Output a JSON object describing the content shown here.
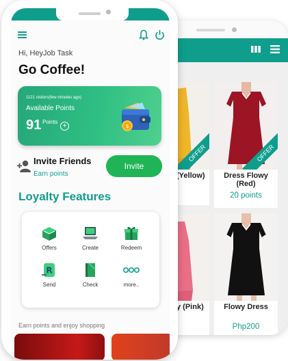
{
  "colors": {
    "primary": "#0f9e8c",
    "points_card": "#2fbf83",
    "invite_button": "#1fb455"
  },
  "home": {
    "greeting": "Hi, HeyJob Task",
    "brand_title": "Go Coffee!",
    "points_card": {
      "visitors_count": "1121 visitors",
      "visitors_note": "(few minutes ago)",
      "label": "Available Points",
      "value": "91",
      "unit": "Points"
    },
    "invite": {
      "title": "Invite Friends",
      "subtitle": "Earn points",
      "button": "Invite"
    },
    "features_title": "Loyalty Features",
    "features": [
      {
        "label": "Offers",
        "icon": "offers-box-icon"
      },
      {
        "label": "Create",
        "icon": "laptop-icon"
      },
      {
        "label": "Redeem",
        "icon": "gift-icon"
      },
      {
        "label": "Send",
        "icon": "send-icon"
      },
      {
        "label": "Check",
        "icon": "book-icon"
      },
      {
        "label": "more..",
        "icon": "more-dots-icon"
      }
    ],
    "footer_text": "Earn points and enjoy shopping"
  },
  "shop": {
    "products": [
      {
        "name": "Dress Flowy (Yellow)",
        "visible_name": "(Yellow)",
        "price": "",
        "ribbon": "OFFER"
      },
      {
        "name": "Dress Flowy (Red)",
        "price": "20 points",
        "ribbon": "OFFER"
      },
      {
        "name": "Dress Flowy (Pink)",
        "visible_name": "y (Pink)",
        "price": ""
      },
      {
        "name": "Flowy Dress",
        "price": "Php200"
      }
    ]
  }
}
